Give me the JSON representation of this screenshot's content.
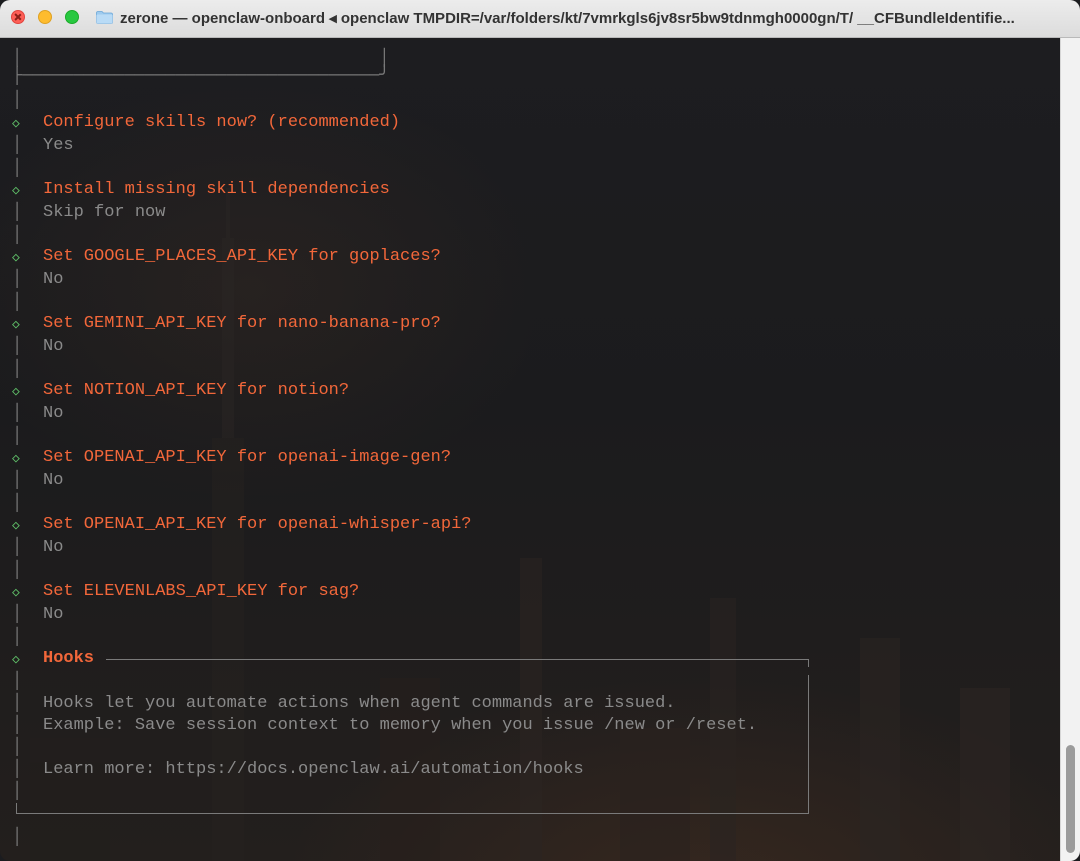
{
  "window": {
    "title": "zerone — openclaw-onboard ◂ openclaw TMPDIR=/var/folders/kt/7vmrkgls6jv8sr5bw9tdnmgh0000gn/T/ __CFBundleIdentifie..."
  },
  "prompts": [
    {
      "question": "Configure skills now? (recommended)",
      "answer": "Yes"
    },
    {
      "question": "Install missing skill dependencies",
      "answer": "Skip for now"
    },
    {
      "question": "Set GOOGLE_PLACES_API_KEY for goplaces?",
      "answer": "No"
    },
    {
      "question": "Set GEMINI_API_KEY for nano-banana-pro?",
      "answer": "No"
    },
    {
      "question": "Set NOTION_API_KEY for notion?",
      "answer": "No"
    },
    {
      "question": "Set OPENAI_API_KEY for openai-image-gen?",
      "answer": "No"
    },
    {
      "question": "Set OPENAI_API_KEY for openai-whisper-api?",
      "answer": "No"
    },
    {
      "question": "Set ELEVENLABS_API_KEY for sag?",
      "answer": "No"
    }
  ],
  "hooks": {
    "title": "Hooks",
    "line1": "Hooks let you automate actions when agent commands are issued.",
    "line2": "Example: Save session context to memory when you issue /new or /reset.",
    "learn_more": "Learn more: https://docs.openclaw.ai/automation/hooks"
  },
  "colors": {
    "prompt": "#f2673a",
    "answer": "#8a8a8a",
    "diamond": "#5fbf68",
    "guide": "#7a7a7a"
  }
}
